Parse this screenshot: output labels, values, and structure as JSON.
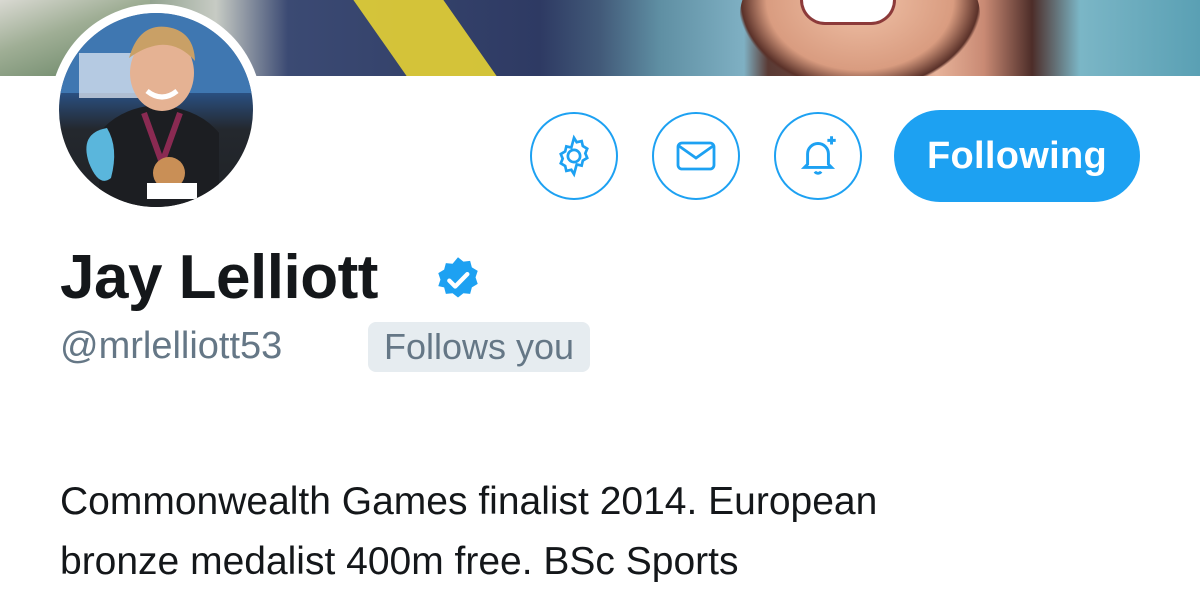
{
  "profile": {
    "name": "Jay Lelliott",
    "handle": "@mrlelliott53",
    "follows_you_badge": "Follows you",
    "verified": true,
    "bio_line1": "Commonwealth Games finalist 2014. European",
    "bio_line2": "bronze medalist 400m free. BSc Sports"
  },
  "actions": {
    "settings_icon": "gear-icon",
    "message_icon": "envelope-icon",
    "notifications_icon": "bell-plus-icon",
    "follow_label": "Following"
  },
  "colors": {
    "accent": "#1da1f2",
    "text_primary": "#14171a",
    "text_secondary": "#657786",
    "badge_bg": "#e6ecf0"
  }
}
